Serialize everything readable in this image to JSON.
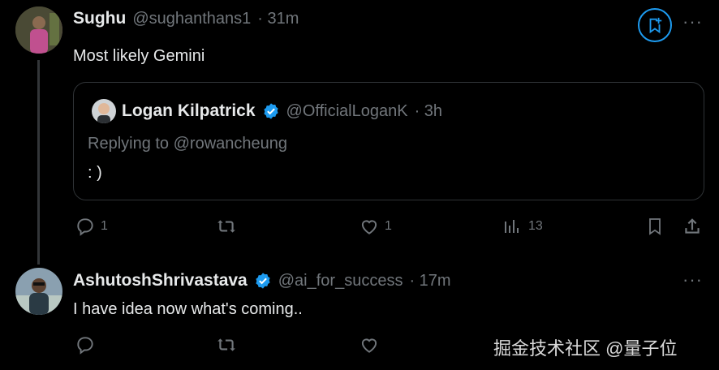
{
  "tweet1": {
    "author_name": "Sughu",
    "handle": "@sughanthans1",
    "time": "· 31m",
    "text": "Most likely Gemini",
    "quote": {
      "author_name": "Logan Kilpatrick",
      "handle": "@OfficialLoganK",
      "time": "· 3h",
      "replying_to": "Replying to @rowancheung",
      "text": ": )"
    },
    "actions": {
      "reply_count": "1",
      "like_count": "1",
      "views_count": "13"
    }
  },
  "tweet2": {
    "author_name": "AshutoshShrivastava",
    "handle": "@ai_for_success",
    "time": "· 17m",
    "text": "I have idea now what's coming.."
  },
  "more_label": "···",
  "watermark": "掘金技术社区 @量子位",
  "colors": {
    "background": "#000000",
    "text": "#e7e9ea",
    "muted": "#71767b",
    "accent": "#1d9bf0"
  }
}
